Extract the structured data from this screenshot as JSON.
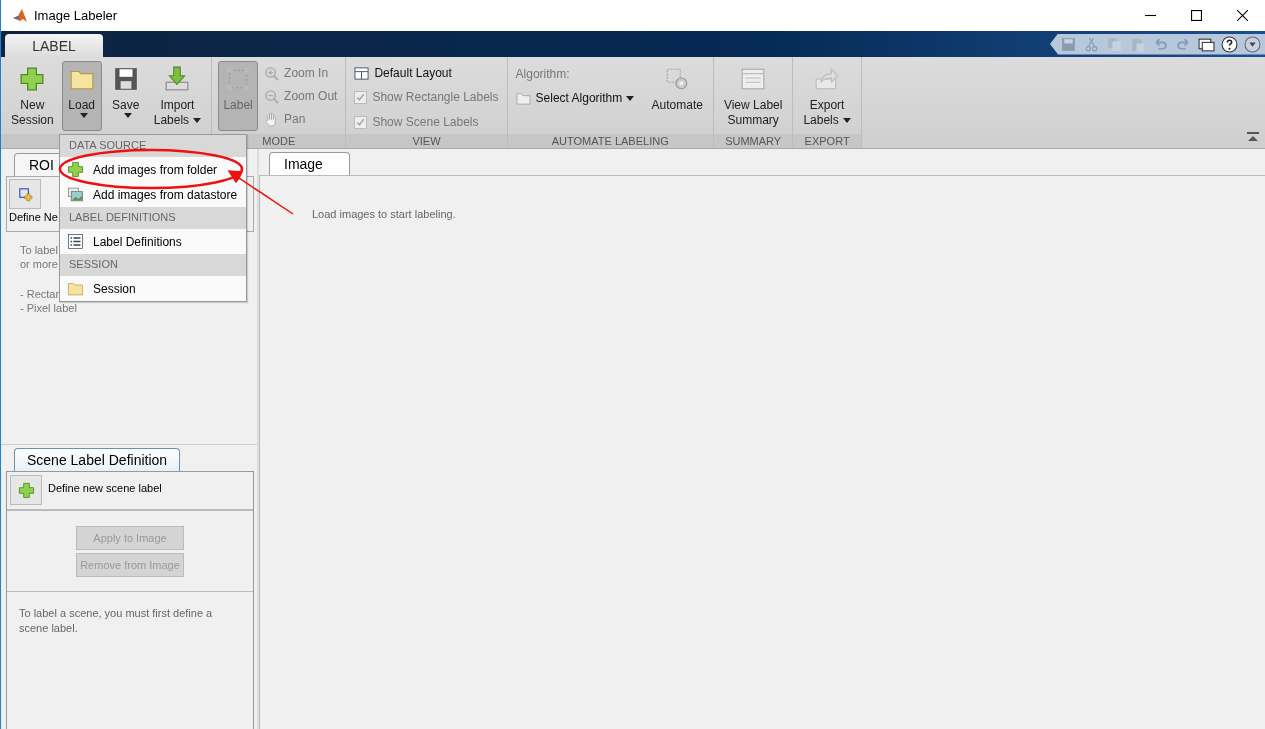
{
  "window": {
    "title": "Image Labeler"
  },
  "ribbon_tabs": [
    {
      "label": "LABEL",
      "selected": true
    }
  ],
  "file_buttons": [
    {
      "kind": "plus",
      "lines": [
        "New",
        "Session"
      ],
      "pressed": false,
      "dropdown": false
    },
    {
      "kind": "folder",
      "lines": [
        "Load"
      ],
      "pressed": true,
      "dropdown": true
    },
    {
      "kind": "disk",
      "lines": [
        "Save"
      ],
      "pressed": false,
      "dropdown": true
    },
    {
      "kind": "import",
      "lines": [
        "Import",
        "Labels"
      ],
      "pressed": false,
      "dropdown": true
    }
  ],
  "mode": {
    "label_button": {
      "label": "Label",
      "pressed": true
    },
    "tools": [
      {
        "kind": "zoom-in",
        "label": "Zoom In"
      },
      {
        "kind": "zoom-out",
        "label": "Zoom Out"
      },
      {
        "kind": "pan",
        "label": "Pan"
      }
    ],
    "section": "MODE"
  },
  "view": {
    "layout": "Default Layout",
    "options": [
      {
        "label": "Show Rectangle Labels",
        "checked": true
      },
      {
        "label": "Show Scene Labels",
        "checked": true
      }
    ],
    "section": "VIEW"
  },
  "automate": {
    "algorithm_label": "Algorithm:",
    "select": "Select Algorithm",
    "button": "Automate",
    "section": "AUTOMATE LABELING"
  },
  "summary": {
    "lines": [
      "View Label",
      "Summary"
    ],
    "section": "SUMMARY"
  },
  "export": {
    "lines": [
      "Export",
      "Labels"
    ],
    "section": "EXPORT"
  },
  "load_menu": [
    {
      "heading": "DATA SOURCE",
      "items": [
        {
          "kind": "plus",
          "label": "Add images from folder"
        },
        {
          "kind": "images",
          "label": "Add images from datastore"
        }
      ]
    },
    {
      "heading": "LABEL DEFINITIONS",
      "items": [
        {
          "kind": "list",
          "label": "Label Definitions"
        }
      ]
    },
    {
      "heading": "SESSION",
      "items": [
        {
          "kind": "folder",
          "label": "Session"
        }
      ]
    }
  ],
  "roi_panel": {
    "tab": "ROI",
    "define": "Define Ne",
    "help_lines": [
      "To label",
      "or more"
    ],
    "types": [
      "- Rectan",
      "- Pixel label"
    ]
  },
  "scene_panel": {
    "tab": "Scene Label Definition",
    "define": "Define new scene label",
    "buttons": [
      {
        "label": "Apply to Image",
        "disabled": true
      },
      {
        "label": "Remove from Image",
        "disabled": true
      }
    ],
    "help": "To label a scene, you must first define a scene label."
  },
  "image_panel": {
    "tab": "Image",
    "message": "Load images to start labeling."
  }
}
